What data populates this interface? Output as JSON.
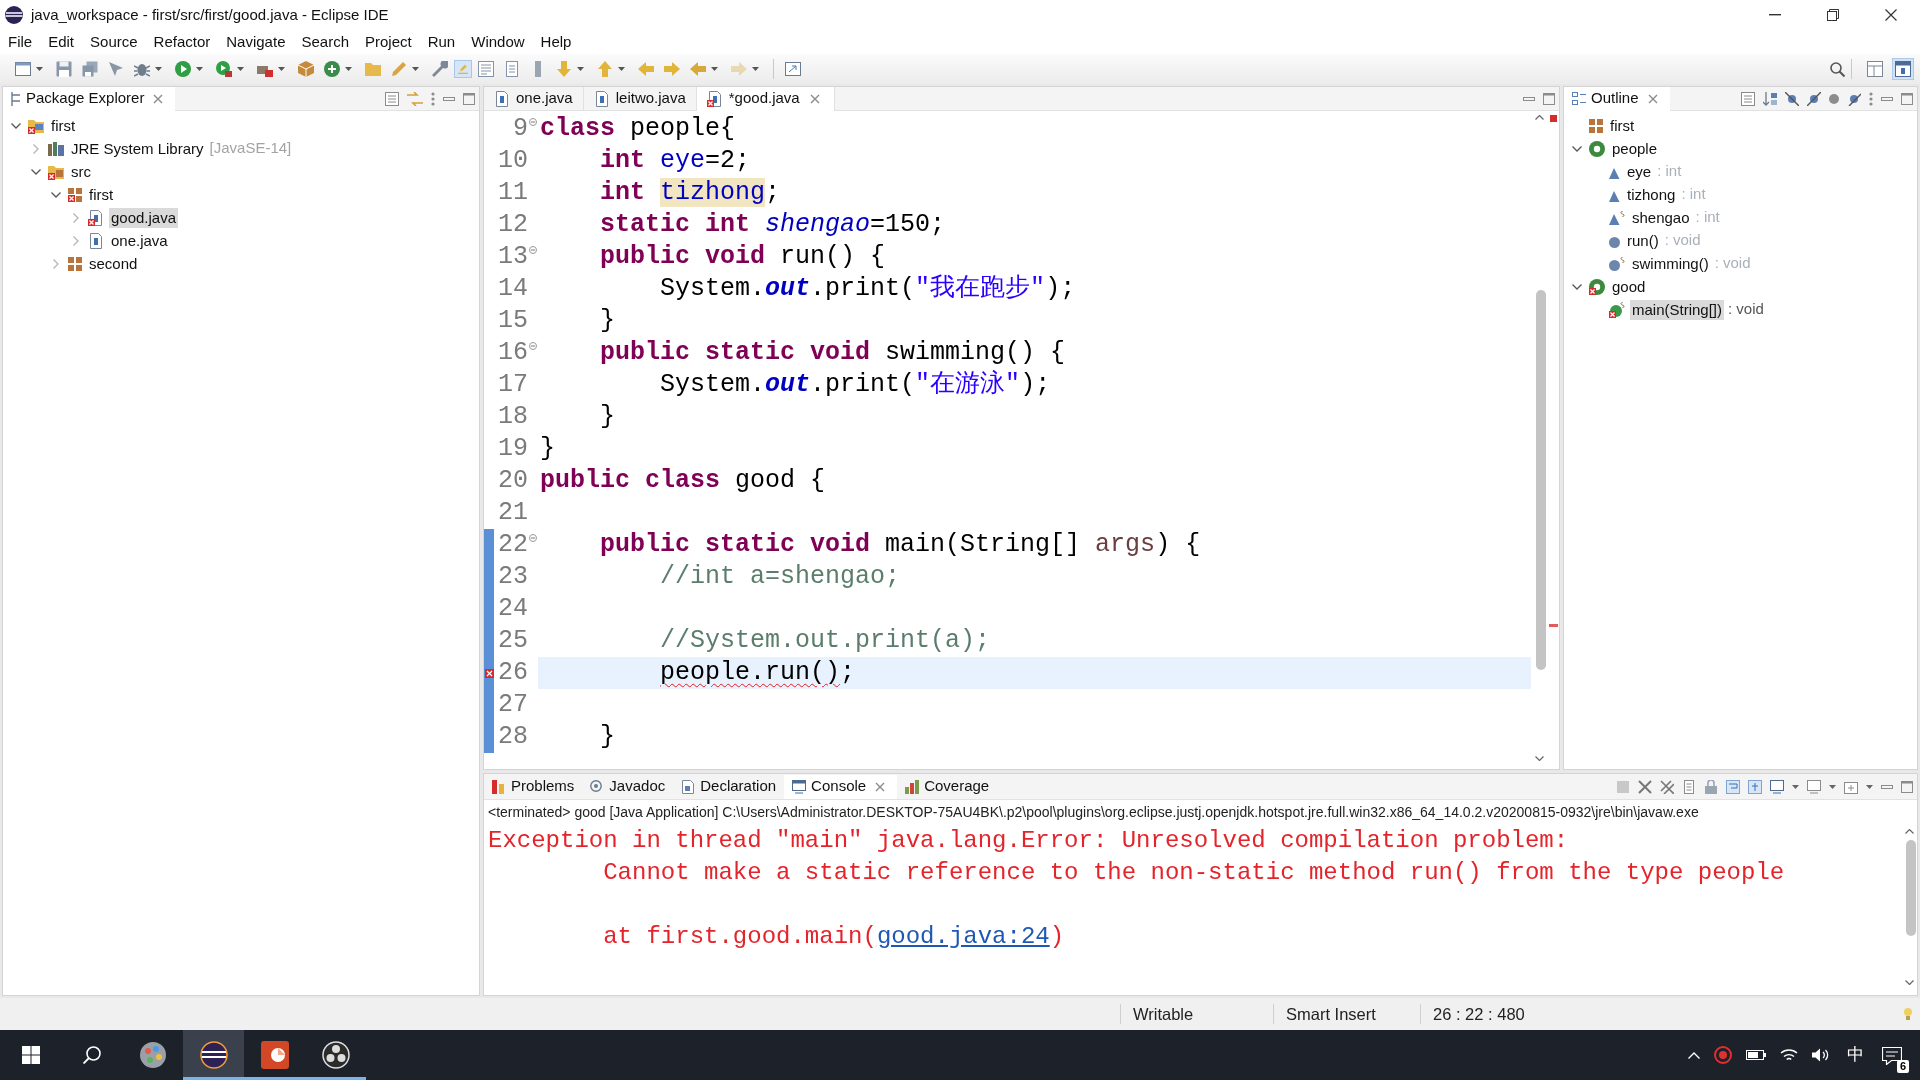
{
  "window": {
    "title": "java_workspace - first/src/first/good.java - Eclipse IDE"
  },
  "menu_bar": [
    "File",
    "Edit",
    "Source",
    "Refactor",
    "Navigate",
    "Search",
    "Project",
    "Run",
    "Window",
    "Help"
  ],
  "toolbar": {
    "buttons": [
      {
        "pressed": false,
        "disabled": false
      },
      {
        "pressed": false,
        "disabled": false
      },
      {
        "pressed": false,
        "disabled": false
      },
      {
        "pressed": false,
        "disabled": false
      },
      {
        "pressed": false,
        "disabled": false
      },
      {
        "pressed": false,
        "disabled": false
      },
      {
        "pressed": false,
        "disabled": false
      },
      {
        "pressed": false,
        "disabled": false
      },
      {
        "pressed": false,
        "disabled": false
      },
      {
        "pressed": false,
        "disabled": false
      },
      {
        "pressed": false,
        "disabled": false
      },
      {
        "pressed": false,
        "disabled": false
      },
      {
        "pressed": false,
        "disabled": false
      },
      {
        "pressed": true,
        "disabled": false
      },
      {
        "pressed": false,
        "disabled": false
      },
      {
        "pressed": false,
        "disabled": false
      },
      {
        "pressed": false,
        "disabled": false
      },
      {
        "pressed": false,
        "disabled": false
      },
      {
        "pressed": false,
        "disabled": false
      },
      {
        "pressed": false,
        "disabled": false
      },
      {
        "pressed": false,
        "disabled": false
      },
      {
        "pressed": false,
        "disabled": false
      },
      {
        "pressed": false,
        "disabled": true
      },
      {
        "pressed": false,
        "disabled": false
      }
    ],
    "perspectives": [
      {
        "selected": false
      },
      {
        "selected": true
      }
    ]
  },
  "package_explorer": {
    "title": "Package Explorer",
    "tree": [
      {
        "label": "first",
        "kind": "project",
        "expanded": true,
        "selected": false,
        "error": true,
        "children": [
          {
            "label": "JRE System Library",
            "decoration": "[JavaSE-14]",
            "kind": "library",
            "expanded": false,
            "selected": false,
            "error": false
          },
          {
            "label": "src",
            "kind": "source-folder",
            "expanded": true,
            "selected": false,
            "error": true,
            "children": [
              {
                "label": "first",
                "kind": "package",
                "expanded": true,
                "selected": false,
                "error": true,
                "children": [
                  {
                    "label": "good.java",
                    "kind": "java-file",
                    "expanded": false,
                    "selected": true,
                    "error": true
                  },
                  {
                    "label": "one.java",
                    "kind": "java-file",
                    "expanded": false,
                    "selected": false,
                    "error": false
                  }
                ]
              },
              {
                "label": "second",
                "kind": "package",
                "expanded": false,
                "selected": false,
                "error": false
              }
            ]
          }
        ]
      }
    ]
  },
  "editor": {
    "tabs": [
      {
        "label": "one.java",
        "selected": false,
        "error": false
      },
      {
        "label": "leitwo.java",
        "selected": false,
        "error": false
      },
      {
        "label": "*good.java",
        "selected": true,
        "error": true
      }
    ],
    "lines": [
      {
        "number": "9",
        "folding": true,
        "changed": false,
        "current": false,
        "error": false,
        "tokens": [
          {
            "text": "class",
            "kind": "keyword"
          },
          {
            "text": " people{",
            "kind": "plain"
          }
        ]
      },
      {
        "number": "10",
        "folding": false,
        "changed": false,
        "current": false,
        "error": false,
        "tokens": [
          {
            "text": "    int",
            "kind": "keyword"
          },
          {
            "text": " eye",
            "kind": "field"
          },
          {
            "text": "=2;",
            "kind": "plain"
          }
        ]
      },
      {
        "number": "11",
        "folding": false,
        "changed": false,
        "current": false,
        "error": false,
        "tokens": [
          {
            "text": "    int ",
            "kind": "keyword"
          },
          {
            "text": "tizhong",
            "kind": "field-occurrence"
          },
          {
            "text": ";",
            "kind": "plain"
          }
        ]
      },
      {
        "number": "12",
        "folding": false,
        "changed": false,
        "current": false,
        "error": false,
        "tokens": [
          {
            "text": "    static int ",
            "kind": "keyword"
          },
          {
            "text": "shengao",
            "kind": "static-field"
          },
          {
            "text": "=150;",
            "kind": "plain"
          }
        ]
      },
      {
        "number": "13",
        "folding": true,
        "changed": false,
        "current": false,
        "error": false,
        "tokens": [
          {
            "text": "    public void",
            "kind": "keyword"
          },
          {
            "text": " run() {",
            "kind": "plain"
          }
        ]
      },
      {
        "number": "14",
        "folding": false,
        "changed": false,
        "current": false,
        "error": false,
        "tokens": [
          {
            "text": "        System.",
            "kind": "plain"
          },
          {
            "text": "out",
            "kind": "static-field-ref"
          },
          {
            "text": ".print(",
            "kind": "plain"
          },
          {
            "text": "\"我在跑步\"",
            "kind": "string"
          },
          {
            "text": ");",
            "kind": "plain"
          }
        ]
      },
      {
        "number": "15",
        "folding": false,
        "changed": false,
        "current": false,
        "error": false,
        "tokens": [
          {
            "text": "    }",
            "kind": "plain"
          }
        ]
      },
      {
        "number": "16",
        "folding": true,
        "changed": false,
        "current": false,
        "error": false,
        "tokens": [
          {
            "text": "    public static void",
            "kind": "keyword"
          },
          {
            "text": " swimming() {",
            "kind": "plain"
          }
        ]
      },
      {
        "number": "17",
        "folding": false,
        "changed": false,
        "current": false,
        "error": false,
        "tokens": [
          {
            "text": "        System.",
            "kind": "plain"
          },
          {
            "text": "out",
            "kind": "static-field-ref"
          },
          {
            "text": ".print(",
            "kind": "plain"
          },
          {
            "text": "\"在游泳\"",
            "kind": "string"
          },
          {
            "text": ");",
            "kind": "plain"
          }
        ]
      },
      {
        "number": "18",
        "folding": false,
        "changed": false,
        "current": false,
        "error": false,
        "tokens": [
          {
            "text": "    }",
            "kind": "plain"
          }
        ]
      },
      {
        "number": "19",
        "folding": false,
        "changed": false,
        "current": false,
        "error": false,
        "tokens": [
          {
            "text": "}",
            "kind": "plain"
          }
        ]
      },
      {
        "number": "20",
        "folding": false,
        "changed": false,
        "current": false,
        "error": false,
        "tokens": [
          {
            "text": "public class",
            "kind": "keyword"
          },
          {
            "text": " good {",
            "kind": "plain"
          }
        ]
      },
      {
        "number": "21",
        "folding": false,
        "changed": false,
        "current": false,
        "error": false
      },
      {
        "number": "22",
        "folding": true,
        "changed": true,
        "current": false,
        "error": false,
        "tokens": [
          {
            "text": "    public static void",
            "kind": "keyword"
          },
          {
            "text": " main(String[] ",
            "kind": "plain"
          },
          {
            "text": "args",
            "kind": "param"
          },
          {
            "text": ") {",
            "kind": "plain"
          }
        ]
      },
      {
        "number": "23",
        "folding": false,
        "changed": true,
        "current": false,
        "error": false,
        "tokens": [
          {
            "text": "        //int a=shengao;",
            "kind": "comment"
          }
        ]
      },
      {
        "number": "24",
        "folding": false,
        "changed": true,
        "current": false,
        "error": false
      },
      {
        "number": "25",
        "folding": false,
        "changed": true,
        "current": false,
        "error": false,
        "tokens": [
          {
            "text": "        //System.out.print(a);",
            "kind": "comment"
          }
        ]
      },
      {
        "number": "26",
        "folding": false,
        "changed": true,
        "current": true,
        "error": true,
        "tokens": [
          {
            "text": "        people.run()",
            "kind": "error"
          },
          {
            "text": ";",
            "kind": "plain"
          }
        ]
      },
      {
        "number": "27",
        "folding": false,
        "changed": true,
        "current": false,
        "error": false
      },
      {
        "number": "28",
        "folding": false,
        "changed": true,
        "current": false,
        "error": false,
        "tokens": [
          {
            "text": "    }",
            "kind": "plain"
          }
        ]
      }
    ]
  },
  "outline": {
    "title": "Outline",
    "tree": [
      {
        "label": "first",
        "kind": "package",
        "selected": false,
        "error": false
      },
      {
        "label": "people",
        "kind": "class",
        "expanded": true,
        "selected": false,
        "error": false,
        "children": [
          {
            "label": "eye",
            "type": ": int",
            "kind": "field",
            "static": false,
            "selected": false,
            "error": false
          },
          {
            "label": "tizhong",
            "type": ": int",
            "kind": "field",
            "static": false,
            "selected": false,
            "error": false
          },
          {
            "label": "shengao",
            "type": ": int",
            "kind": "field",
            "static": true,
            "selected": false,
            "error": false
          },
          {
            "label": "run()",
            "type": ": void",
            "kind": "method",
            "static": false,
            "selected": false,
            "error": false
          },
          {
            "label": "swimming()",
            "type": ": void",
            "kind": "method",
            "static": true,
            "selected": false,
            "error": false
          }
        ]
      },
      {
        "label": "good",
        "kind": "class",
        "expanded": true,
        "selected": false,
        "error": true,
        "children": [
          {
            "label": "main(String[])",
            "type": ": void",
            "kind": "public-method",
            "static": true,
            "selected": true,
            "error": true
          }
        ]
      }
    ]
  },
  "bottom_panel": {
    "tabs": [
      {
        "label": "Problems",
        "selected": false
      },
      {
        "label": "Javadoc",
        "selected": false
      },
      {
        "label": "Declaration",
        "selected": false
      },
      {
        "label": "Console",
        "selected": true
      },
      {
        "label": "Coverage",
        "selected": false
      }
    ],
    "process_line": "<terminated> good [Java Application] C:\\Users\\Administrator.DESKTOP-75AU4BK\\.p2\\pool\\plugins\\org.eclipse.justj.openjdk.hotspot.jre.full.win32.x86_64_14.0.2.v20200815-0932\\jre\\bin\\javaw.exe",
    "output": [
      {
        "kind": "text",
        "text": "Exception in thread \"main\" java.lang.Error: Unresolved compilation problem:",
        "indented": false
      },
      {
        "kind": "text",
        "text": "Cannot make a static reference to the non-static method run() from the type people",
        "indented": true
      },
      {
        "kind": "blank"
      },
      {
        "kind": "trace",
        "text": "at first.good.main(",
        "link": "good.java:24",
        "after": ")",
        "indented": true
      }
    ]
  },
  "status_bar": [
    "Writable",
    "Smart Insert",
    "26 : 22 : 480"
  ],
  "taskbar": {
    "apps": [
      {
        "running": false,
        "selected": false
      },
      {
        "running": true,
        "selected": true
      },
      {
        "running": true,
        "selected": false
      },
      {
        "running": true,
        "selected": false
      }
    ],
    "input_method": "中",
    "notification_count": "6"
  }
}
